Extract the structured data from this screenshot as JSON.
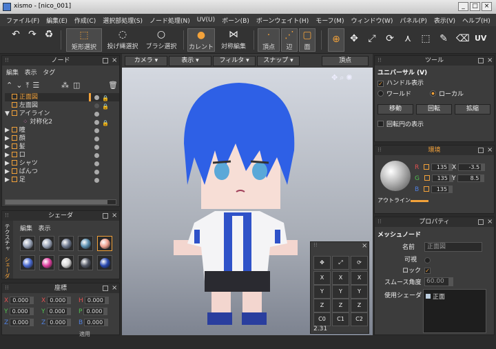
{
  "window": {
    "title": "xismo - [nico_001]",
    "min": "_",
    "max": "□",
    "close": "×"
  },
  "menu": [
    "ファイル(F)",
    "編集(E)",
    "作成(C)",
    "選択部処理(S)",
    "ノード処理(N)",
    "UV(U)",
    "ボーン(B)",
    "ボーンウェイト(H)",
    "モーフ(M)",
    "ウィンドウ(W)",
    "パネル(P)",
    "表示(V)",
    "ヘルプ(H)"
  ],
  "toolbar": {
    "rect_select": "矩形選択",
    "lasso_select": "投げ縄選択",
    "brush_select": "ブラシ選択",
    "cursor": "カレント",
    "symmetric": "対称編集",
    "vertex": "頂点",
    "edge": "辺",
    "face": "面",
    "uv": "UV"
  },
  "node_panel": {
    "title": "ノード",
    "menu": [
      "編集",
      "表示",
      "タグ"
    ],
    "nodes": [
      {
        "label": "正面図",
        "indent": 1,
        "selected": true,
        "lock": true
      },
      {
        "label": "左面図",
        "indent": 1,
        "lock": true
      },
      {
        "label": "アイライン",
        "indent": 0,
        "expand": "▼"
      },
      {
        "label": "対称化2",
        "indent": 2,
        "lock": true
      },
      {
        "label": "瞳",
        "indent": 0,
        "expand": "▶"
      },
      {
        "label": "顔",
        "indent": 0,
        "expand": "▶"
      },
      {
        "label": "髪",
        "indent": 0,
        "expand": "▶"
      },
      {
        "label": "口",
        "indent": 0,
        "expand": "▶"
      },
      {
        "label": "シャツ",
        "indent": 0,
        "expand": "▶"
      },
      {
        "label": "ぱんつ",
        "indent": 0,
        "expand": "▶"
      },
      {
        "label": "足",
        "indent": 0,
        "expand": "▶"
      }
    ]
  },
  "shader_panel": {
    "title": "シェーダ",
    "menu": [
      "編集",
      "表示"
    ],
    "side_tabs": [
      "テクスチャ",
      "シェーダ"
    ],
    "balls": [
      "#9aa4b8",
      "#9aa4b8",
      "#6f7a90",
      "#5a8fb0",
      "#f0a090",
      "#4a6ad0",
      "#e040a0",
      "#d8d8d8",
      "#555a66",
      "#2a4ab0"
    ]
  },
  "coord_panel": {
    "title": "座標",
    "rows": [
      [
        {
          "l": "X",
          "c": "#e05050",
          "v": "0.000"
        },
        {
          "l": "X",
          "c": "#e05050",
          "v": "0.000"
        },
        {
          "l": "H",
          "c": "#e05050",
          "v": "0.000"
        }
      ],
      [
        {
          "l": "Y",
          "c": "#50c050",
          "v": "0.000"
        },
        {
          "l": "Y",
          "c": "#50c050",
          "v": "0.000"
        },
        {
          "l": "P",
          "c": "#50c050",
          "v": "0.000"
        }
      ],
      [
        {
          "l": "Z",
          "c": "#5080e0",
          "v": "0.000"
        },
        {
          "l": "Z",
          "c": "#5080e0",
          "v": "0.000"
        },
        {
          "l": "B",
          "c": "#5080e0",
          "v": "0.000"
        }
      ]
    ],
    "apply": "適用"
  },
  "viewport": {
    "buttons": [
      "カメラ",
      "表示",
      "フィルタ",
      "スナップ"
    ],
    "mode": "頂点"
  },
  "grid_panel": {
    "rows": [
      [
        "X",
        "X",
        "X"
      ],
      [
        "Y",
        "Y",
        "Y"
      ],
      [
        "Z",
        "Z",
        "Z"
      ],
      [
        "C0",
        "C1",
        "C2"
      ]
    ],
    "value": "2.31"
  },
  "tool_panel": {
    "title": "ツール",
    "mode": "ユニバーサル (V)",
    "handle": "ハンドル表示",
    "world": "ワールド",
    "local": "ローカル",
    "move": "移動",
    "rotate": "回転",
    "scale": "拡縮",
    "show_circle": "回転円の表示"
  },
  "env_panel": {
    "title": "環境",
    "R": "135",
    "G": "135",
    "B": "135",
    "X": "-3.5",
    "Y": "8.5",
    "outline": "アウトライン"
  },
  "prop_panel": {
    "title": "プロパティ",
    "section": "メッシュノード",
    "name_label": "名前",
    "name_value": "正面図",
    "visible": "可視",
    "lock": "ロック",
    "smooth_label": "スムース角度",
    "smooth_value": "60.00",
    "shader_label": "使用シェーダ",
    "shader_value": "正面"
  }
}
